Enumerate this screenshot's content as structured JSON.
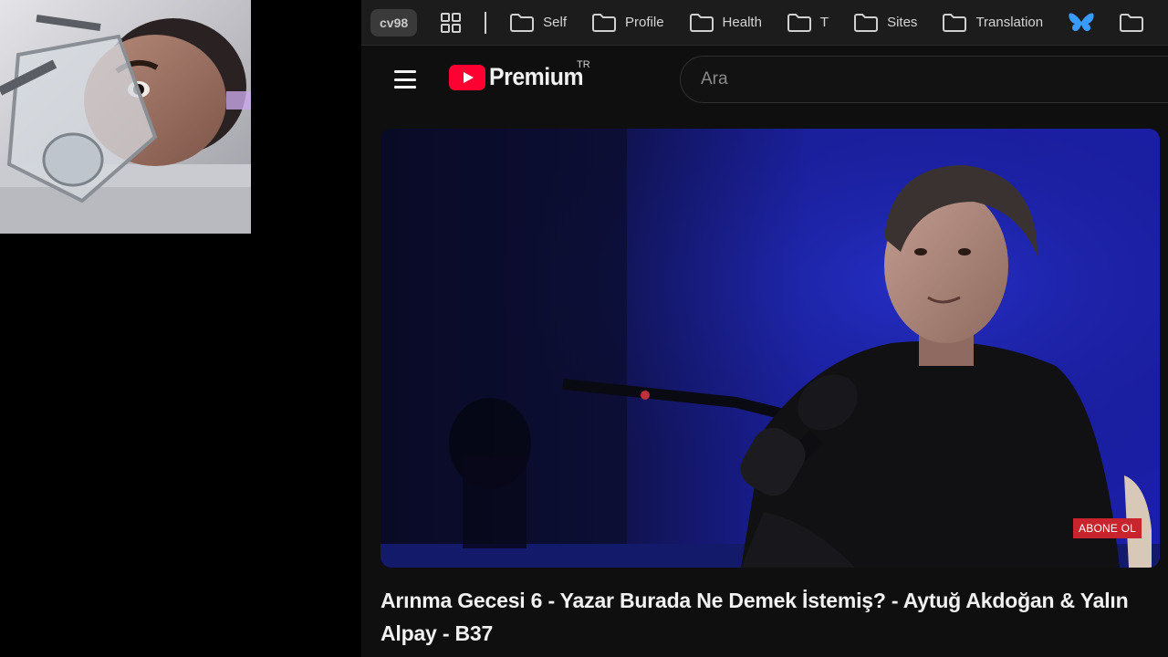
{
  "bookmarks": {
    "profile": "cv98",
    "items": [
      {
        "label": "Self"
      },
      {
        "label": "Profile"
      },
      {
        "label": "Health"
      },
      {
        "label": "T"
      },
      {
        "label": "Sites"
      },
      {
        "label": "Translation"
      }
    ]
  },
  "header": {
    "logo_text": "Premium",
    "region": "TR",
    "search_placeholder": "Ara"
  },
  "video": {
    "badge": "ABONE OL",
    "title": "Arınma Gecesi 6 - Yazar Burada Ne Demek İstemiş? - Aytuğ Akdoğan & Yalın Alpay - B37"
  },
  "colors": {
    "youtube_red": "#ff0033",
    "background": "#0f0f0f",
    "bookmarks_bar": "#1c1c1c",
    "butterfly_blue": "#3a9bff"
  }
}
